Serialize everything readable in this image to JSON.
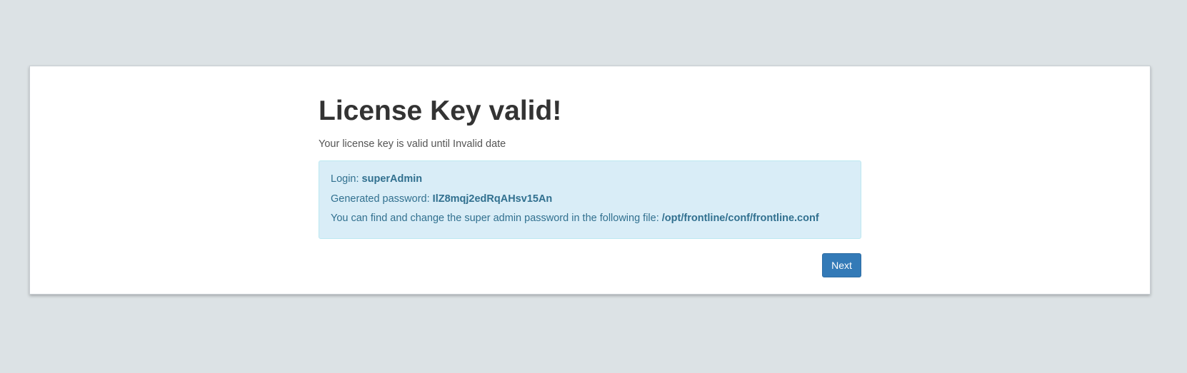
{
  "page": {
    "title": "License Key valid!",
    "subtitle": "Your license key is valid until Invalid date"
  },
  "info": {
    "login_label": "Login: ",
    "login_value": "superAdmin",
    "password_label": "Generated password: ",
    "password_value": "IlZ8mqj2edRqAHsv15An",
    "file_label": "You can find and change the super admin password in the following file: ",
    "file_value": "/opt/frontline/conf/frontline.conf"
  },
  "actions": {
    "next_label": "Next"
  },
  "colors": {
    "background": "#dce2e5",
    "info_background": "#d9edf7",
    "info_text": "#31708f",
    "primary_button": "#337ab7"
  }
}
